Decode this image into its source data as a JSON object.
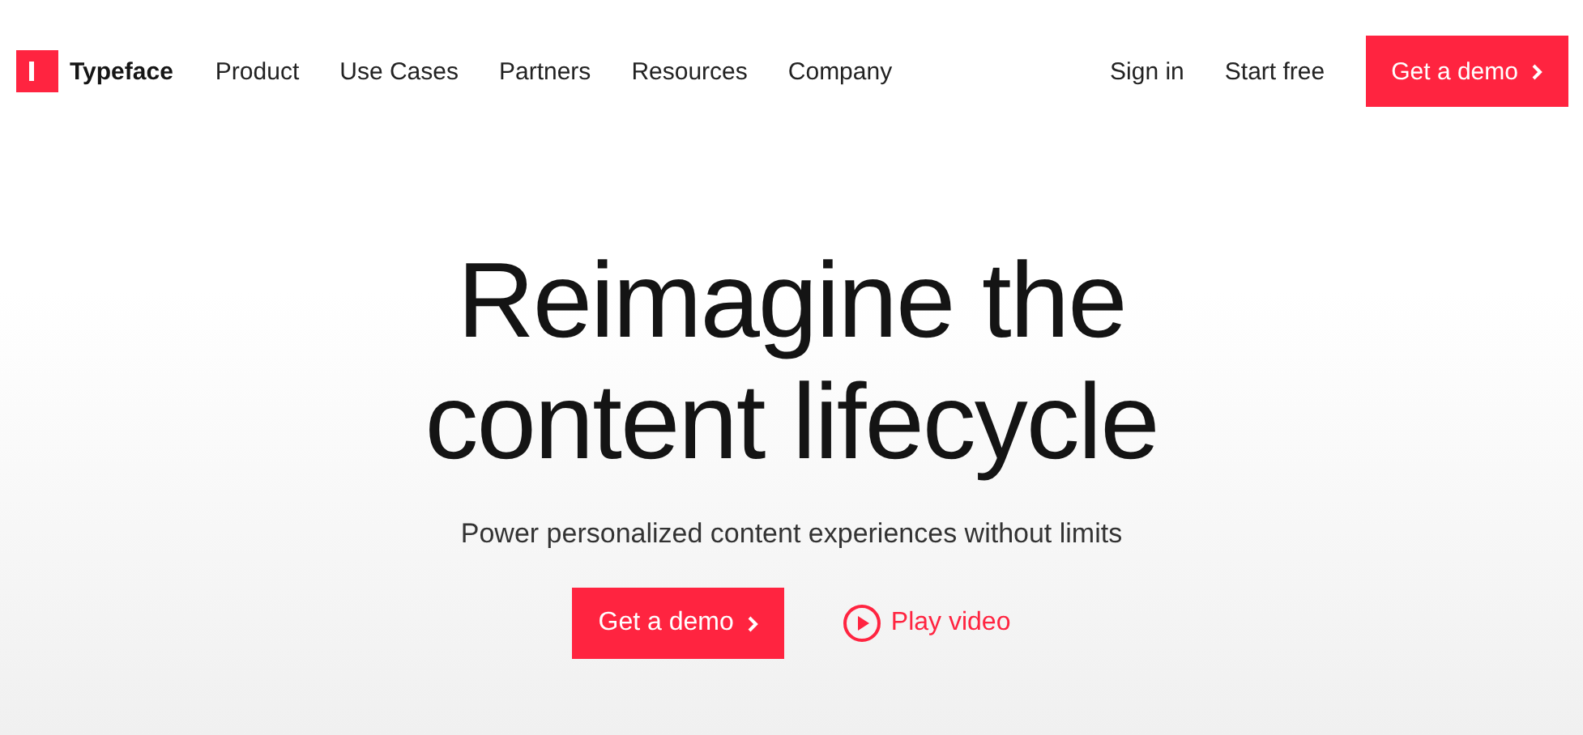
{
  "brand": {
    "name": "Typeface"
  },
  "nav": {
    "links": [
      "Product",
      "Use Cases",
      "Partners",
      "Resources",
      "Company"
    ],
    "actions": [
      "Sign in",
      "Start free"
    ],
    "cta": "Get a demo"
  },
  "hero": {
    "heading_lines": [
      "Reimagine the",
      "content lifecycle"
    ],
    "subtitle": "Power personalized content experiences without limits",
    "primary_button": "Get a demo",
    "video_link": "Play video"
  }
}
